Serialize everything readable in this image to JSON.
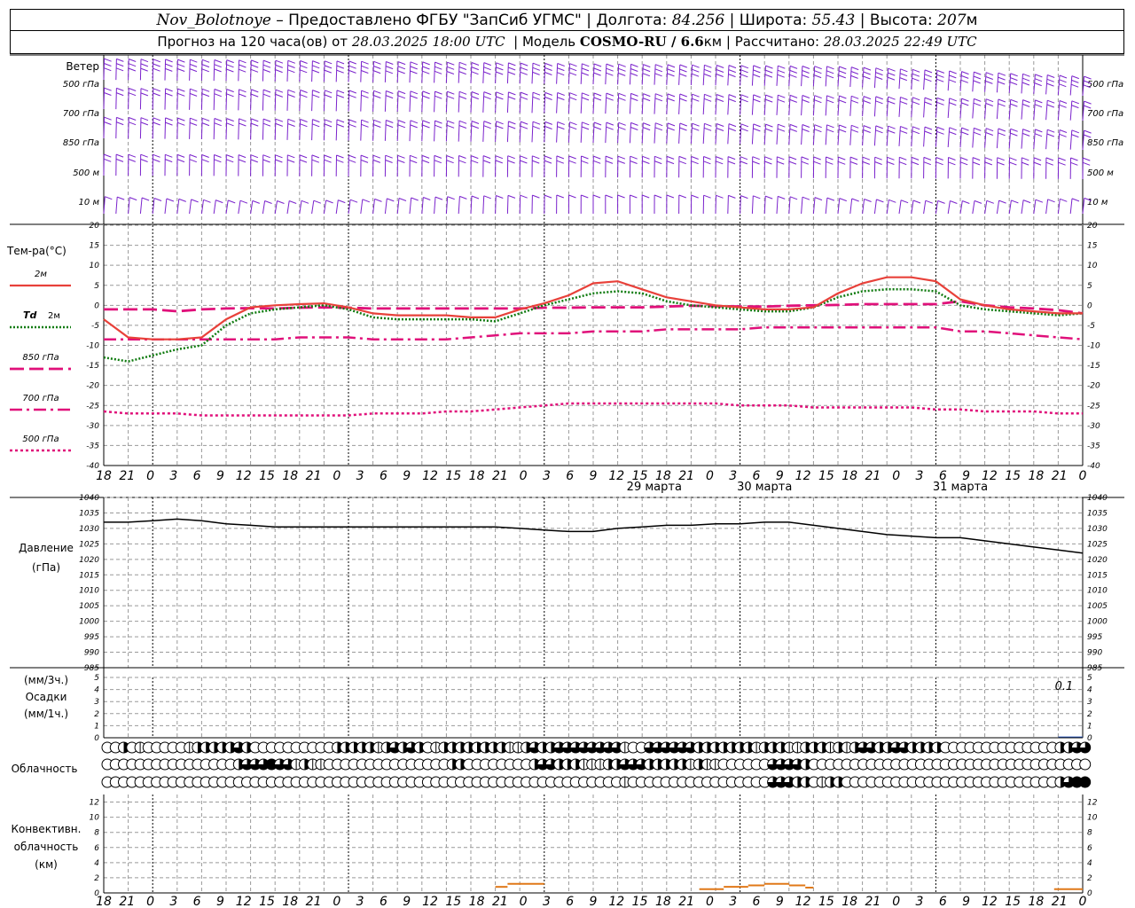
{
  "header": {
    "station": "Nov_Bolotnoye",
    "sep1": " – ",
    "provider": "Предоставлено ФГБУ \"ЗапСиб УГМС\"",
    "lon_label": "Долгота:",
    "lon": "84.256",
    "lat_label": "Широта:",
    "lat": "55.43",
    "alt_label": "Высота:",
    "alt": "207",
    "alt_unit": "м",
    "forecast_label": "Прогноз на 120 часа(ов) от",
    "forecast_start": "28.03.2025 18:00 UTC",
    "model_label": "Модель",
    "model": "COSMO-RU / 6.6",
    "model_unit": "км",
    "calc_label": "Рассчитано:",
    "calc_time": "28.03.2025 22:49 UTC"
  },
  "colors": {
    "wind": "#7a22cc",
    "t2m": "#e8413a",
    "td2m": "#0e7a0e",
    "t850": "#e0107a",
    "t700": "#e0107a",
    "t500": "#e0107a",
    "pressure": "#000000",
    "precip": "#2a5ccc",
    "convective": "#e07818",
    "grid": "#999999"
  },
  "chart_data": [
    {
      "type": "wind_barbs",
      "panel": "wind",
      "title": "Ветер",
      "levels": [
        "500 гПа",
        "700 гПа",
        "850 гПа",
        "500 м",
        "10 м"
      ]
    },
    {
      "type": "line",
      "panel": "temperature",
      "title": "Тем-ра(°C)",
      "ylim": [
        -40,
        20
      ],
      "yticks": [
        20,
        15,
        10,
        5,
        0,
        -5,
        -10,
        -15,
        -20,
        -25,
        -30,
        -35,
        -40
      ],
      "x_hours": [
        0,
        3,
        6,
        9,
        12,
        15,
        18,
        21,
        24,
        27,
        30,
        33,
        36,
        39,
        42,
        45,
        48,
        51,
        54,
        57,
        60,
        63,
        66,
        69,
        72,
        75,
        78,
        81,
        84,
        87,
        90,
        93,
        96,
        99,
        102,
        105,
        108,
        111,
        114,
        117,
        120
      ],
      "series": [
        {
          "name": "2м",
          "values": [
            -3.5,
            -8,
            -8.5,
            -8.5,
            -8,
            -3.5,
            -0.5,
            0,
            0.3,
            0.5,
            -0.5,
            -2,
            -2.5,
            -2.5,
            -2.5,
            -3,
            -3,
            -1,
            0.5,
            2.5,
            5.5,
            6,
            4,
            2,
            1,
            0,
            -0.5,
            -1,
            -1,
            -0.5,
            3,
            5.5,
            7,
            7,
            6,
            1.5,
            0,
            -1,
            -1.5,
            -2,
            -2
          ]
        },
        {
          "name": "Td 2м",
          "values": [
            -13,
            -14,
            -12.5,
            -11,
            -10,
            -5,
            -2,
            -1,
            -0.5,
            0,
            -1,
            -3,
            -3.5,
            -3.5,
            -3.5,
            -3.5,
            -4,
            -2,
            0,
            1.5,
            3,
            3.5,
            3,
            1,
            0,
            -0.5,
            -1,
            -1.5,
            -1.5,
            -0.5,
            2,
            3.5,
            4,
            4,
            3.5,
            0,
            -1,
            -1.5,
            -2,
            -2.5,
            -2
          ]
        },
        {
          "name": "850 гПа",
          "values": [
            -1,
            -1,
            -1,
            -1.5,
            -1,
            -0.8,
            -0.7,
            -0.8,
            -0.6,
            -0.5,
            -0.6,
            -0.8,
            -0.8,
            -0.8,
            -0.8,
            -0.8,
            -0.8,
            -0.8,
            -0.6,
            -0.6,
            -0.5,
            -0.5,
            -0.5,
            -0.3,
            -0.1,
            -0.2,
            -0.3,
            -0.3,
            -0.1,
            0,
            0.1,
            0.3,
            0.3,
            0.3,
            0.3,
            1,
            0,
            -0.5,
            -0.8,
            -1.2,
            -2
          ]
        },
        {
          "name": "700 гПа",
          "values": [
            -8.5,
            -8.5,
            -8.5,
            -8.5,
            -8.5,
            -8.5,
            -8.5,
            -8.5,
            -8,
            -8,
            -8,
            -8.5,
            -8.5,
            -8.5,
            -8.5,
            -8,
            -7.5,
            -7,
            -7,
            -7,
            -6.5,
            -6.5,
            -6.5,
            -6,
            -6,
            -6,
            -6,
            -5.5,
            -5.5,
            -5.5,
            -5.5,
            -5.5,
            -5.5,
            -5.5,
            -5.5,
            -6.5,
            -6.5,
            -7,
            -7.5,
            -8,
            -8.5
          ]
        },
        {
          "name": "500 гПа",
          "values": [
            -26.5,
            -27,
            -27,
            -27,
            -27.5,
            -27.5,
            -27.5,
            -27.5,
            -27.5,
            -27.5,
            -27.5,
            -27,
            -27,
            -27,
            -26.5,
            -26.5,
            -26,
            -25.5,
            -25,
            -24.5,
            -24.5,
            -24.5,
            -24.5,
            -24.5,
            -24.5,
            -24.5,
            -25,
            -25,
            -25,
            -25.5,
            -25.5,
            -25.5,
            -25.5,
            -25.5,
            -26,
            -26,
            -26.5,
            -26.5,
            -26.5,
            -27,
            -27
          ]
        }
      ]
    },
    {
      "type": "line",
      "panel": "pressure",
      "title": "Давление",
      "unit": "(гПа)",
      "ylim": [
        985,
        1040
      ],
      "yticks": [
        1040,
        1035,
        1030,
        1025,
        1020,
        1015,
        1010,
        1005,
        1000,
        995,
        990,
        985
      ],
      "x_hours": [
        0,
        3,
        6,
        9,
        12,
        15,
        18,
        21,
        24,
        27,
        30,
        33,
        36,
        39,
        42,
        45,
        48,
        51,
        54,
        57,
        60,
        63,
        66,
        69,
        72,
        75,
        78,
        81,
        84,
        87,
        90,
        93,
        96,
        99,
        102,
        105,
        108,
        111,
        114,
        117,
        120
      ],
      "values": [
        1032,
        1032,
        1032.5,
        1033,
        1032.5,
        1031.5,
        1031,
        1030.5,
        1030.5,
        1030.5,
        1030.5,
        1030.5,
        1030.5,
        1030.5,
        1030.5,
        1030.5,
        1030.5,
        1030,
        1029.5,
        1029,
        1029,
        1030,
        1030.5,
        1031,
        1031,
        1031.5,
        1031.5,
        1032,
        1032,
        1031,
        1030,
        1029,
        1028,
        1027.5,
        1027,
        1027,
        1026,
        1025,
        1024,
        1023,
        1022
      ]
    },
    {
      "type": "bar",
      "panel": "precipitation",
      "title": "Осадки",
      "units_top": "(мм/3ч.)",
      "units_bottom": "(мм/1ч.)",
      "ylim": [
        0,
        5
      ],
      "yticks": [
        5,
        4,
        3,
        2,
        1,
        0
      ],
      "annotation": "0.1",
      "bars": [
        {
          "x_hours": 117,
          "value": 0.1
        }
      ]
    },
    {
      "type": "table",
      "panel": "cloudiness",
      "title": "Облачность",
      "rows": [
        "0,0,2,0,1,0,0,0,0,0,1,2,2,2,2,2,3,2,0,0,0,0,0,0,0,0,0,0,2,2,2,2,2,1,2,3,2,3,2,0,1,2,2,2,2,2,2,2,2,1,1,2,3,2,2,3,3,3,3,3,3,3,3,1,0,0,3,3,3,3,3,3,2,2,2,2,2,2,2,1,2,2,2,1,1,2,2,2,1,2,1,2,3,3,2,2,3,3,2,2,2,2,0,0,0,0,0,0,0,0,0,0,0,0,0,0,2,2,3,3",
        "0,0,0,0,0,0,0,0,0,0,0,0,0,0,0,0,2,3,3,3,4,3,3,1,2,1,1,0,0,0,0,0,0,0,0,0,0,0,0,0,0,0,2,2,0,0,0,0,0,0,0,0,2,3,3,2,2,2,1,1,1,2,2,3,3,3,2,2,2,2,2,1,2,1,1,0,0,0,0,0,0,3,3,3,3,2,0,0,0,0,0,0,0,0,0,0,0,0,0,0,0,0,0,0,0,0,0,0,0,0,0,0,0,0,0,0,0,0,0,0",
        "0,0,0,0,0,0,0,0,0,0,0,0,0,0,0,0,0,0,0,0,0,0,0,0,0,0,0,0,0,0,0,0,0,0,0,0,0,0,0,0,0,0,0,0,0,0,0,0,0,0,0,0,0,0,0,0,0,0,0,0,0,0,0,1,0,0,0,0,0,0,0,0,0,0,0,0,0,0,0,0,0,3,3,3,2,2,0,1,2,2,0,0,0,0,0,0,0,0,0,0,0,0,0,0,0,0,0,0,0,0,0,0,0,0,0,0,2,3,4,4"
      ]
    },
    {
      "type": "bar",
      "panel": "convective_cloudiness",
      "title": "Конвективн.",
      "title2": "облачность",
      "unit": "(км)",
      "ylim": [
        0,
        13
      ],
      "yticks": [
        12,
        10,
        8,
        6,
        4,
        2,
        0
      ],
      "segments": [
        {
          "from_hour": 48,
          "to_hour": 49.5,
          "base": 0,
          "top": 0.8
        },
        {
          "from_hour": 49.5,
          "to_hour": 54,
          "base": 0,
          "top": 1.2
        },
        {
          "from_hour": 73,
          "to_hour": 76,
          "base": 0,
          "top": 0.5
        },
        {
          "from_hour": 76,
          "to_hour": 79,
          "base": 0,
          "top": 0.8
        },
        {
          "from_hour": 79,
          "to_hour": 81,
          "base": 0,
          "top": 1
        },
        {
          "from_hour": 81,
          "to_hour": 84,
          "base": 0,
          "top": 1.2
        },
        {
          "from_hour": 84,
          "to_hour": 86,
          "base": 0,
          "top": 1
        },
        {
          "from_hour": 86,
          "to_hour": 87,
          "base": 0,
          "top": 0.7
        },
        {
          "from_hour": 116.5,
          "to_hour": 120,
          "base": 0,
          "top": 0.5
        }
      ]
    }
  ],
  "x_axis": {
    "tick_labels": [
      "18",
      "21",
      "0",
      "3",
      "6",
      "9",
      "12",
      "15",
      "18",
      "21",
      "0",
      "3",
      "6",
      "9",
      "12",
      "15",
      "18",
      "21",
      "0",
      "3",
      "6",
      "9",
      "12",
      "15",
      "18",
      "21",
      "0",
      "3",
      "6",
      "9",
      "12",
      "15",
      "18",
      "21",
      "0",
      "3",
      "6",
      "9",
      "12",
      "15",
      "18",
      "21",
      "0"
    ],
    "date_labels": [
      {
        "at_hour": 57,
        "text": "29 марта"
      },
      {
        "at_hour": 81,
        "text": "30 марта"
      },
      {
        "at_hour": 105,
        "text": "31 марта"
      }
    ]
  },
  "legend": {
    "items": [
      {
        "label": "2м",
        "style": "solid",
        "color": "#e8413a"
      },
      {
        "label_prefix": "Td",
        "label": "2м",
        "style": "dotted",
        "color": "#0e7a0e"
      },
      {
        "label": "850 гПа",
        "style": "dash",
        "color": "#e0107a"
      },
      {
        "label": "700 гПа",
        "style": "dashdot",
        "color": "#e0107a"
      },
      {
        "label": "500 гПа",
        "style": "fine",
        "color": "#e0107a"
      }
    ]
  }
}
